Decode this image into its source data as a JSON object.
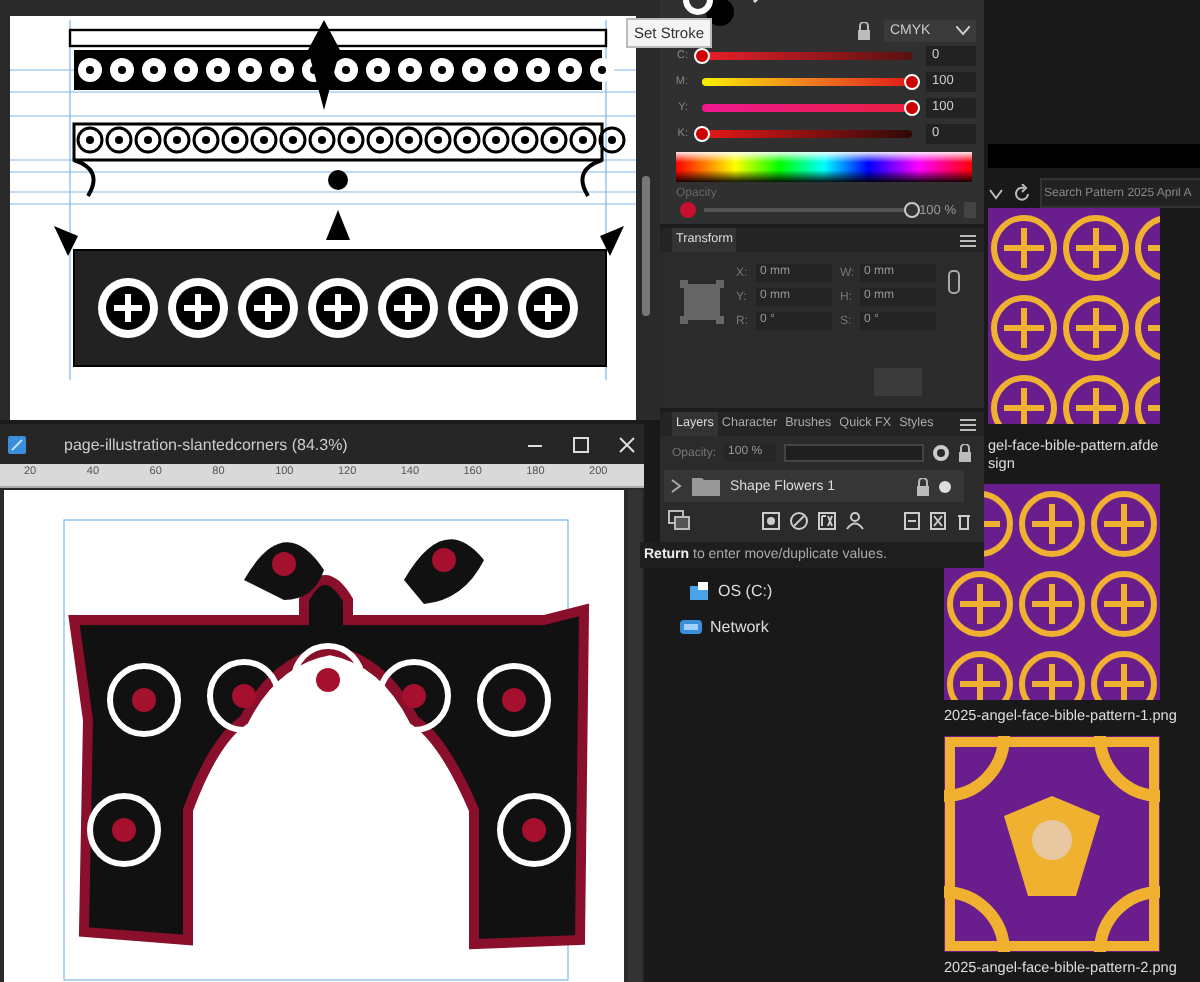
{
  "tooltip": "Set Stroke",
  "color_panel": {
    "mode": "CMYK",
    "channels": [
      {
        "name": "C:",
        "level": 0,
        "reading": "0"
      },
      {
        "name": "M:",
        "level": 1,
        "reading": "100"
      },
      {
        "name": "Y:",
        "level": 1,
        "reading": "100"
      },
      {
        "name": "K:",
        "level": 0,
        "reading": "0"
      }
    ],
    "opacity": {
      "label": "Opacity",
      "level": 1,
      "reading": "100 %"
    }
  },
  "transform_panel": {
    "title": "Transform",
    "fields": [
      {
        "label": "X:",
        "value": "0 mm"
      },
      {
        "label": "W:",
        "value": "0 mm"
      },
      {
        "label": "Y:",
        "value": "0 mm"
      },
      {
        "label": "H:",
        "value": "0 mm"
      },
      {
        "label": "R:",
        "value": "0 °"
      },
      {
        "label": "S:",
        "value": "0 °"
      }
    ]
  },
  "layers_panel": {
    "tabs": [
      {
        "label": "Layers",
        "selected": true
      },
      {
        "label": "Character",
        "selected": false
      },
      {
        "label": "Brushes",
        "selected": false
      },
      {
        "label": "Quick FX",
        "selected": false
      },
      {
        "label": "Styles",
        "selected": false
      }
    ],
    "opacity": {
      "label": "Opacity:",
      "value": "100 %"
    },
    "layers": [
      {
        "name": "Shape Flowers 1",
        "expanded": false
      }
    ]
  },
  "hint": "**Return** to enter move/duplicate values.",
  "explorer": {
    "search": {
      "placeholder": "Search Pattern 2025 April A"
    },
    "nav": [
      {
        "label": "OS (C:)",
        "kind": "drive"
      },
      {
        "label": "Network",
        "kind": "network"
      }
    ],
    "files": [
      {
        "name": "gel-face-bible-pattern.afdesign",
        "kind": "cross"
      },
      {
        "name": "2025-angel-face-bible-pattern-1.png",
        "kind": "cross"
      },
      {
        "name": "2025-angel-face-bible-pattern-2.png",
        "kind": "tile"
      }
    ]
  },
  "document": {
    "title": "page-illustration-slantedcorners (84.3%)",
    "ruler": [
      "20",
      "40",
      "60",
      "80",
      "100",
      "120",
      "140",
      "160",
      "180",
      "200"
    ]
  }
}
